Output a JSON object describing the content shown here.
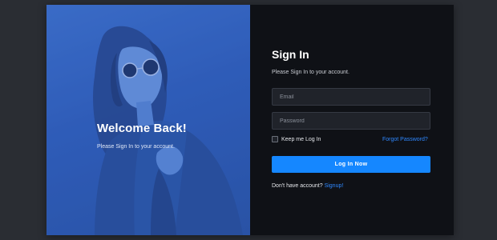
{
  "hero": {
    "title": "Welcome Back!",
    "subtitle": "Please Sign In to your account."
  },
  "form": {
    "title": "Sign In",
    "subtitle": "Please Sign In to your account.",
    "email_placeholder": "Email",
    "password_placeholder": "Password",
    "remember_label": "Keep me Log In",
    "remember_checked": false,
    "forgot_label": "Forgot Password?",
    "submit_label": "Log In Now",
    "no_account_text": "Don't have account?",
    "signup_label": "Signup!"
  },
  "colors": {
    "page_bg": "#2a2d33",
    "panel_bg": "#0f1116",
    "hero_tint": "#3565c2",
    "accent": "#1587ff",
    "link": "#2f88ff",
    "input_bg": "#20232a"
  },
  "icons": {
    "hero_image": "woman-with-sunglasses-photo"
  }
}
